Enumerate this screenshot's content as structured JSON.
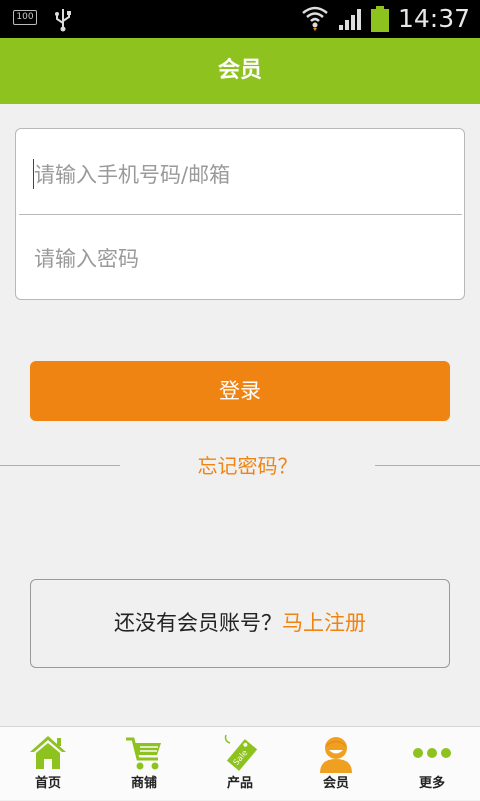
{
  "status_bar": {
    "battery_small_label": "100",
    "time": "14:37"
  },
  "header": {
    "title": "会员"
  },
  "form": {
    "phone_placeholder": "请输入手机号码/邮箱",
    "password_placeholder": "请输入密码"
  },
  "login_button": "登录",
  "forgot_password": "忘记密码？",
  "register": {
    "prompt": "还没有会员账号？",
    "link": "马上注册"
  },
  "bottom_nav": {
    "items": [
      {
        "label": "首页",
        "icon": "home-icon"
      },
      {
        "label": "商铺",
        "icon": "cart-icon"
      },
      {
        "label": "产品",
        "icon": "sale-tag-icon"
      },
      {
        "label": "会员",
        "icon": "member-icon"
      },
      {
        "label": "更多",
        "icon": "more-icon"
      }
    ]
  },
  "colors": {
    "header": "#8dc21f",
    "accent": "#f08413",
    "nav_icon_green": "#8dc21f",
    "member_icon": "#f0a020"
  }
}
